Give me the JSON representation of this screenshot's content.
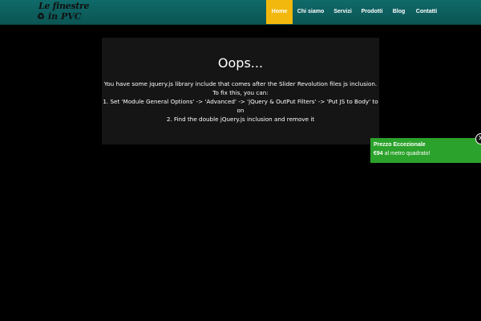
{
  "header": {
    "logo": {
      "line1": "Le finestre",
      "line2": "in PVC",
      "icon": "recycle-icon"
    },
    "nav": [
      {
        "label": "Home",
        "active": true
      },
      {
        "label": "Chi siamo",
        "active": false
      },
      {
        "label": "Servizi",
        "active": false
      },
      {
        "label": "Prodotti",
        "active": false
      },
      {
        "label": "Blog",
        "active": false
      },
      {
        "label": "Contatti",
        "active": false
      }
    ]
  },
  "error_box": {
    "title": "Oops...",
    "lines": [
      "You have some jquery.js library include that comes after the Slider Revolution files js inclusion.",
      "To fix this, you can:",
      "1. Set 'Module General Options' -> 'Advanced' -> 'jQuery & OutPut Filters' -> 'Put JS to Body' to",
      "on",
      "2. Find the double jQuery.js inclusion and remove it"
    ]
  },
  "promo": {
    "title": "Prezzo Eccezionale",
    "price": "€94",
    "text": " al metro quadrato!",
    "close_icon": "close-icon"
  },
  "colors": {
    "header": "#0f6a69",
    "nav_active": "#f2b80e",
    "promo": "#2ba22b",
    "background": "#000000",
    "box": "#151515"
  }
}
